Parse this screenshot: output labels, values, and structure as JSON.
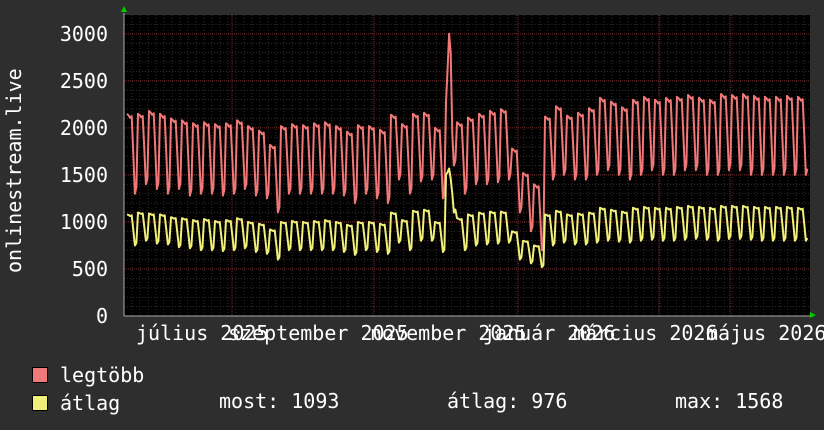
{
  "chart_data": {
    "type": "line",
    "ylabel": "onlinestream.live",
    "ylim": [
      0,
      3200
    ],
    "y_ticks": [
      "0",
      "500",
      "1000",
      "1500",
      "2000",
      "2500",
      "3000"
    ],
    "x_ticks": [
      "július 2025",
      "szeptember 2025",
      "november 2025",
      "január 2026",
      "március 2026",
      "május 2026"
    ],
    "grid": true,
    "colors": {
      "background": "#000000",
      "grid_minor": "#3a2a2a",
      "grid_major": "#7a3030",
      "axis_arrow": "#00cc00"
    },
    "series": [
      {
        "name": "legtöbb",
        "color": "#f07878",
        "base": [
          2150,
          2150,
          2180,
          2150,
          2100,
          2080,
          2050,
          2060,
          2040,
          2050,
          2080,
          2020,
          1970,
          1820,
          2020,
          2040,
          2030,
          2050,
          2060,
          2020,
          1960,
          2030,
          2020,
          1980,
          2140,
          2040,
          2150,
          2160,
          2000,
          2270,
          2060,
          2110,
          2150,
          2180,
          2200,
          1780,
          1520,
          1400,
          2120,
          2230,
          2130,
          2160,
          2210,
          2320,
          2280,
          2220,
          2300,
          2330,
          2300,
          2320,
          2330,
          2350,
          2320,
          2300,
          2360,
          2350,
          2360,
          2340,
          2330,
          2330,
          2340,
          2330
        ],
        "low": [
          1300,
          1400,
          1350,
          1300,
          1350,
          1280,
          1300,
          1300,
          1280,
          1300,
          1350,
          1280,
          1250,
          1100,
          1300,
          1300,
          1300,
          1300,
          1300,
          1280,
          1200,
          1300,
          1250,
          1200,
          1450,
          1300,
          1430,
          1450,
          1250,
          1600,
          1300,
          1400,
          1400,
          1420,
          1450,
          1100,
          900,
          700,
          1450,
          1500,
          1450,
          1450,
          1500,
          1550,
          1500,
          1450,
          1500,
          1550,
          1500,
          1500,
          1550,
          1550,
          1500,
          1500,
          1550,
          1550,
          1500,
          1500,
          1500,
          1500,
          1500,
          1500
        ]
      },
      {
        "name": "átlag",
        "color": "#f0f078",
        "base": [
          1080,
          1100,
          1090,
          1080,
          1050,
          1040,
          1020,
          1030,
          1010,
          1020,
          1040,
          1000,
          980,
          920,
          1000,
          1010,
          1000,
          1010,
          1020,
          1000,
          970,
          1000,
          1000,
          980,
          1100,
          1020,
          1120,
          1130,
          1000,
          1500,
          1040,
          1080,
          1100,
          1110,
          1110,
          900,
          800,
          750,
          1080,
          1120,
          1080,
          1090,
          1100,
          1150,
          1130,
          1110,
          1150,
          1160,
          1150,
          1150,
          1160,
          1170,
          1160,
          1150,
          1170,
          1170,
          1170,
          1160,
          1160,
          1160,
          1160,
          1150
        ],
        "low": [
          750,
          800,
          770,
          760,
          730,
          720,
          700,
          700,
          690,
          700,
          720,
          680,
          660,
          600,
          700,
          700,
          700,
          700,
          700,
          680,
          650,
          700,
          680,
          660,
          780,
          700,
          800,
          800,
          680,
          1100,
          700,
          750,
          760,
          770,
          780,
          600,
          560,
          520,
          750,
          780,
          760,
          760,
          780,
          800,
          790,
          780,
          800,
          810,
          800,
          800,
          810,
          820,
          810,
          800,
          820,
          820,
          810,
          800,
          800,
          800,
          800,
          800
        ]
      }
    ],
    "spike": {
      "series": "legtöbb",
      "value": 3000,
      "avg_value": 1568
    }
  },
  "legend": {
    "item1": "legtöbb",
    "item2": "átlag",
    "swatch1": "#f07878",
    "swatch2": "#f0f078"
  },
  "stats": {
    "most": "most: 1093",
    "atlag": "átlag: 976",
    "max": "max: 1568"
  }
}
